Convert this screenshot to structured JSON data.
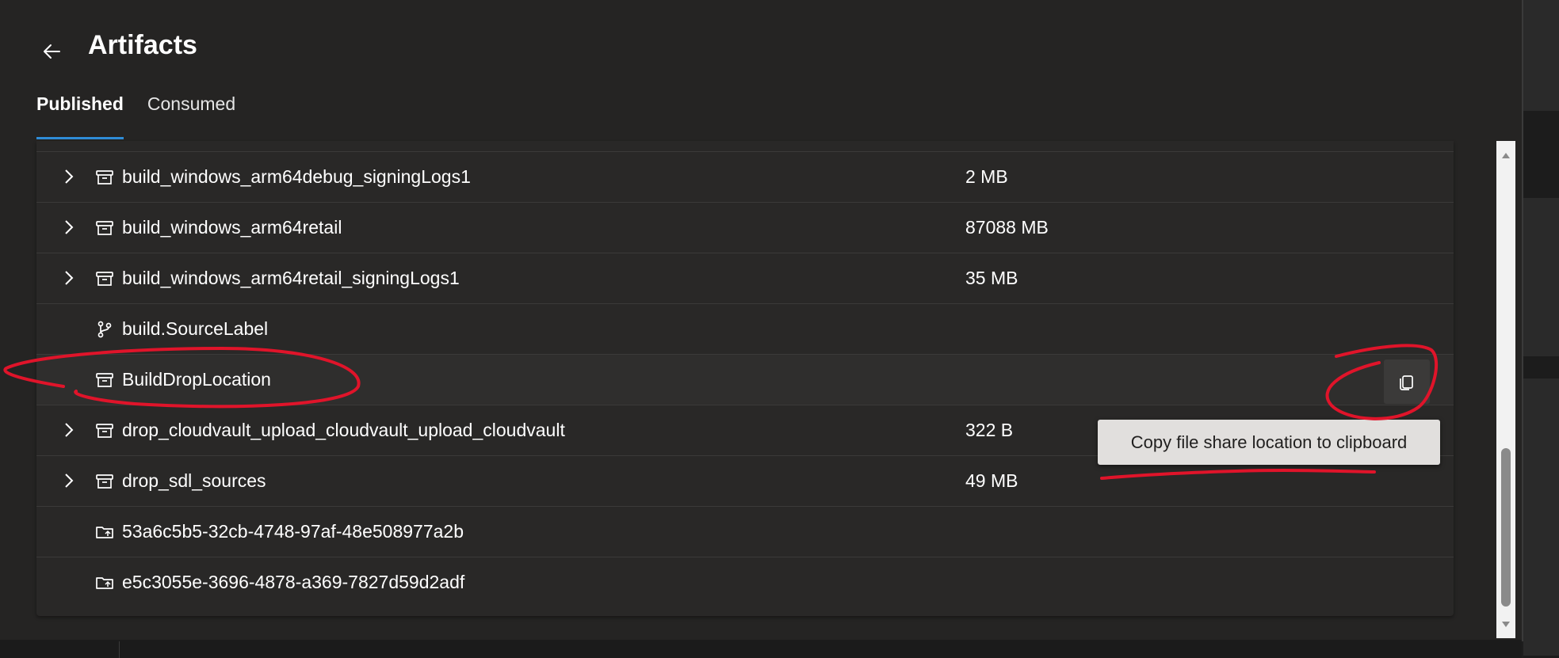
{
  "header": {
    "title": "Artifacts",
    "back_icon": "arrow-left-icon"
  },
  "tabs": [
    {
      "label": "Published",
      "active": true
    },
    {
      "label": "Consumed",
      "active": false
    }
  ],
  "artifacts": [
    {
      "name": "build_windows_arm64debug_signingLogs1",
      "size": "2 MB",
      "icon": "archive-icon",
      "expandable": true
    },
    {
      "name": "build_windows_arm64retail",
      "size": "87088 MB",
      "icon": "archive-icon",
      "expandable": true
    },
    {
      "name": "build_windows_arm64retail_signingLogs1",
      "size": "35 MB",
      "icon": "archive-icon",
      "expandable": true
    },
    {
      "name": "build.SourceLabel",
      "size": "",
      "icon": "branch-icon",
      "expandable": false
    },
    {
      "name": "BuildDropLocation",
      "size": "",
      "icon": "archive-icon",
      "expandable": false,
      "highlighted": true
    },
    {
      "name": "drop_cloudvault_upload_cloudvault_upload_cloudvault",
      "size": "322 B",
      "icon": "archive-icon",
      "expandable": true
    },
    {
      "name": "drop_sdl_sources",
      "size": "49 MB",
      "icon": "archive-icon",
      "expandable": true
    },
    {
      "name": "53a6c5b5-32cb-4748-97af-48e508977a2b",
      "size": "",
      "icon": "folder-share-icon",
      "expandable": false
    },
    {
      "name": "e5c3055e-3696-4878-a369-7827d59d2adf",
      "size": "",
      "icon": "folder-share-icon",
      "expandable": false
    }
  ],
  "tooltip": {
    "text": "Copy file share location to clipboard"
  },
  "colors": {
    "panel_bg": "#252423",
    "list_bg": "#292827",
    "accent": "#2f8cd7",
    "annotation": "#e0142a"
  }
}
